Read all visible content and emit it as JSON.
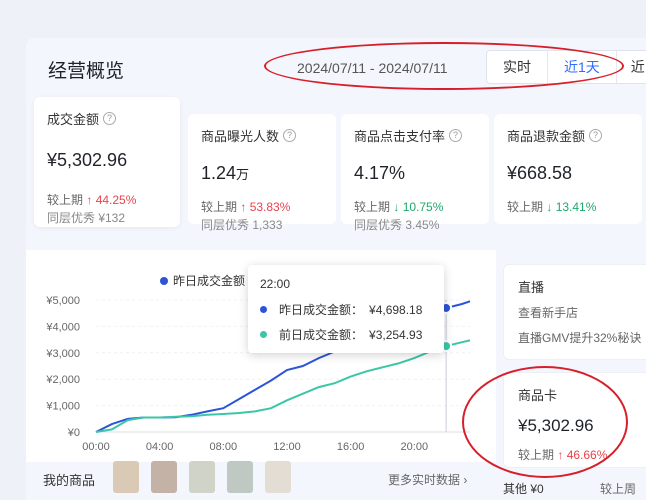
{
  "header": {
    "title": "经营概览",
    "date_range": "2024/07/11 - 2024/07/11",
    "tabs": [
      "实时",
      "近1天",
      "近"
    ]
  },
  "kpis": [
    {
      "label": "成交金额",
      "value": "¥5,302.96",
      "unit": "",
      "cmp_label": "较上期",
      "cmp_arrow": "↑",
      "cmp_value": "44.25%",
      "peer": "同层优秀 ¥132"
    },
    {
      "label": "商品曝光人数",
      "value": "1.24",
      "unit": "万",
      "cmp_label": "较上期",
      "cmp_arrow": "↑",
      "cmp_value": "53.83%",
      "peer": "同层优秀 1,333"
    },
    {
      "label": "商品点击支付率",
      "value": "4.17%",
      "unit": "",
      "cmp_label": "较上期",
      "cmp_arrow": "↓",
      "cmp_value": "10.75%",
      "peer": "同层优秀 3.45%"
    },
    {
      "label": "商品退款金额",
      "value": "¥668.58",
      "unit": "",
      "cmp_label": "较上期",
      "cmp_arrow": "↓",
      "cmp_value": "13.41%",
      "peer": ""
    }
  ],
  "colors": {
    "yesterday": "#2c54d6",
    "before": "#3cc6a8",
    "up": "#e8434d",
    "down": "#1fa86b",
    "annotation": "#d81e2a"
  },
  "chart_data": {
    "type": "line",
    "legend": "昨日成交金额",
    "x_labels": [
      "00:00",
      "04:00",
      "08:00",
      "12:00",
      "16:00",
      "20:00"
    ],
    "y_labels": [
      "¥0",
      "¥1,000",
      "¥2,000",
      "¥3,000",
      "¥4,000",
      "¥5,000"
    ],
    "ylim": [
      0,
      5000
    ],
    "xlim": [
      0,
      23.5
    ],
    "series": [
      {
        "name": "昨日成交金额",
        "x": [
          0,
          1,
          2,
          3,
          4,
          5,
          6,
          7,
          8,
          9,
          10,
          11,
          12,
          13,
          14,
          15,
          16,
          17,
          18,
          19,
          20,
          21,
          22,
          23,
          23.5
        ],
        "y": [
          0,
          300,
          500,
          550,
          550,
          560,
          650,
          780,
          900,
          1250,
          1600,
          1950,
          2350,
          2500,
          2800,
          3050,
          3350,
          3650,
          3900,
          4150,
          4400,
          4550,
          4698,
          4850,
          4950
        ]
      },
      {
        "name": "前日成交金额",
        "x": [
          0,
          1,
          2,
          3,
          4,
          5,
          6,
          7,
          8,
          9,
          10,
          11,
          12,
          13,
          14,
          15,
          16,
          17,
          18,
          19,
          20,
          21,
          22,
          23,
          23.5
        ],
        "y": [
          0,
          100,
          450,
          550,
          550,
          580,
          600,
          650,
          680,
          720,
          780,
          900,
          1200,
          1450,
          1700,
          1850,
          2100,
          2300,
          2450,
          2600,
          2800,
          3050,
          3255,
          3400,
          3470
        ]
      }
    ]
  },
  "tooltip": {
    "time": "22:00",
    "rows": [
      {
        "label": "昨日成交金额：",
        "value": "¥4,698.18"
      },
      {
        "label": "前日成交金额：",
        "value": "¥3,254.93"
      }
    ]
  },
  "side": {
    "live_title": "直播",
    "live_line1": "查看新手店",
    "live_line2": "直播GMV提升32%秘诀",
    "goods_title": "商品卡",
    "goods_value": "¥5,302.96",
    "goods_cmp_label": "较上期",
    "goods_cmp_arrow": "↑",
    "goods_cmp_value": "46.66%",
    "others": "其他 ¥0",
    "others_cmp": "较上周期"
  },
  "bottom": {
    "my_goods": "我的商品",
    "more": "更多实时数据 ›",
    "thumb_colors": [
      "#d9c9b5",
      "#c4b2a6",
      "#cfd3c8",
      "#bfc8c2",
      "#e4ddd3"
    ]
  }
}
